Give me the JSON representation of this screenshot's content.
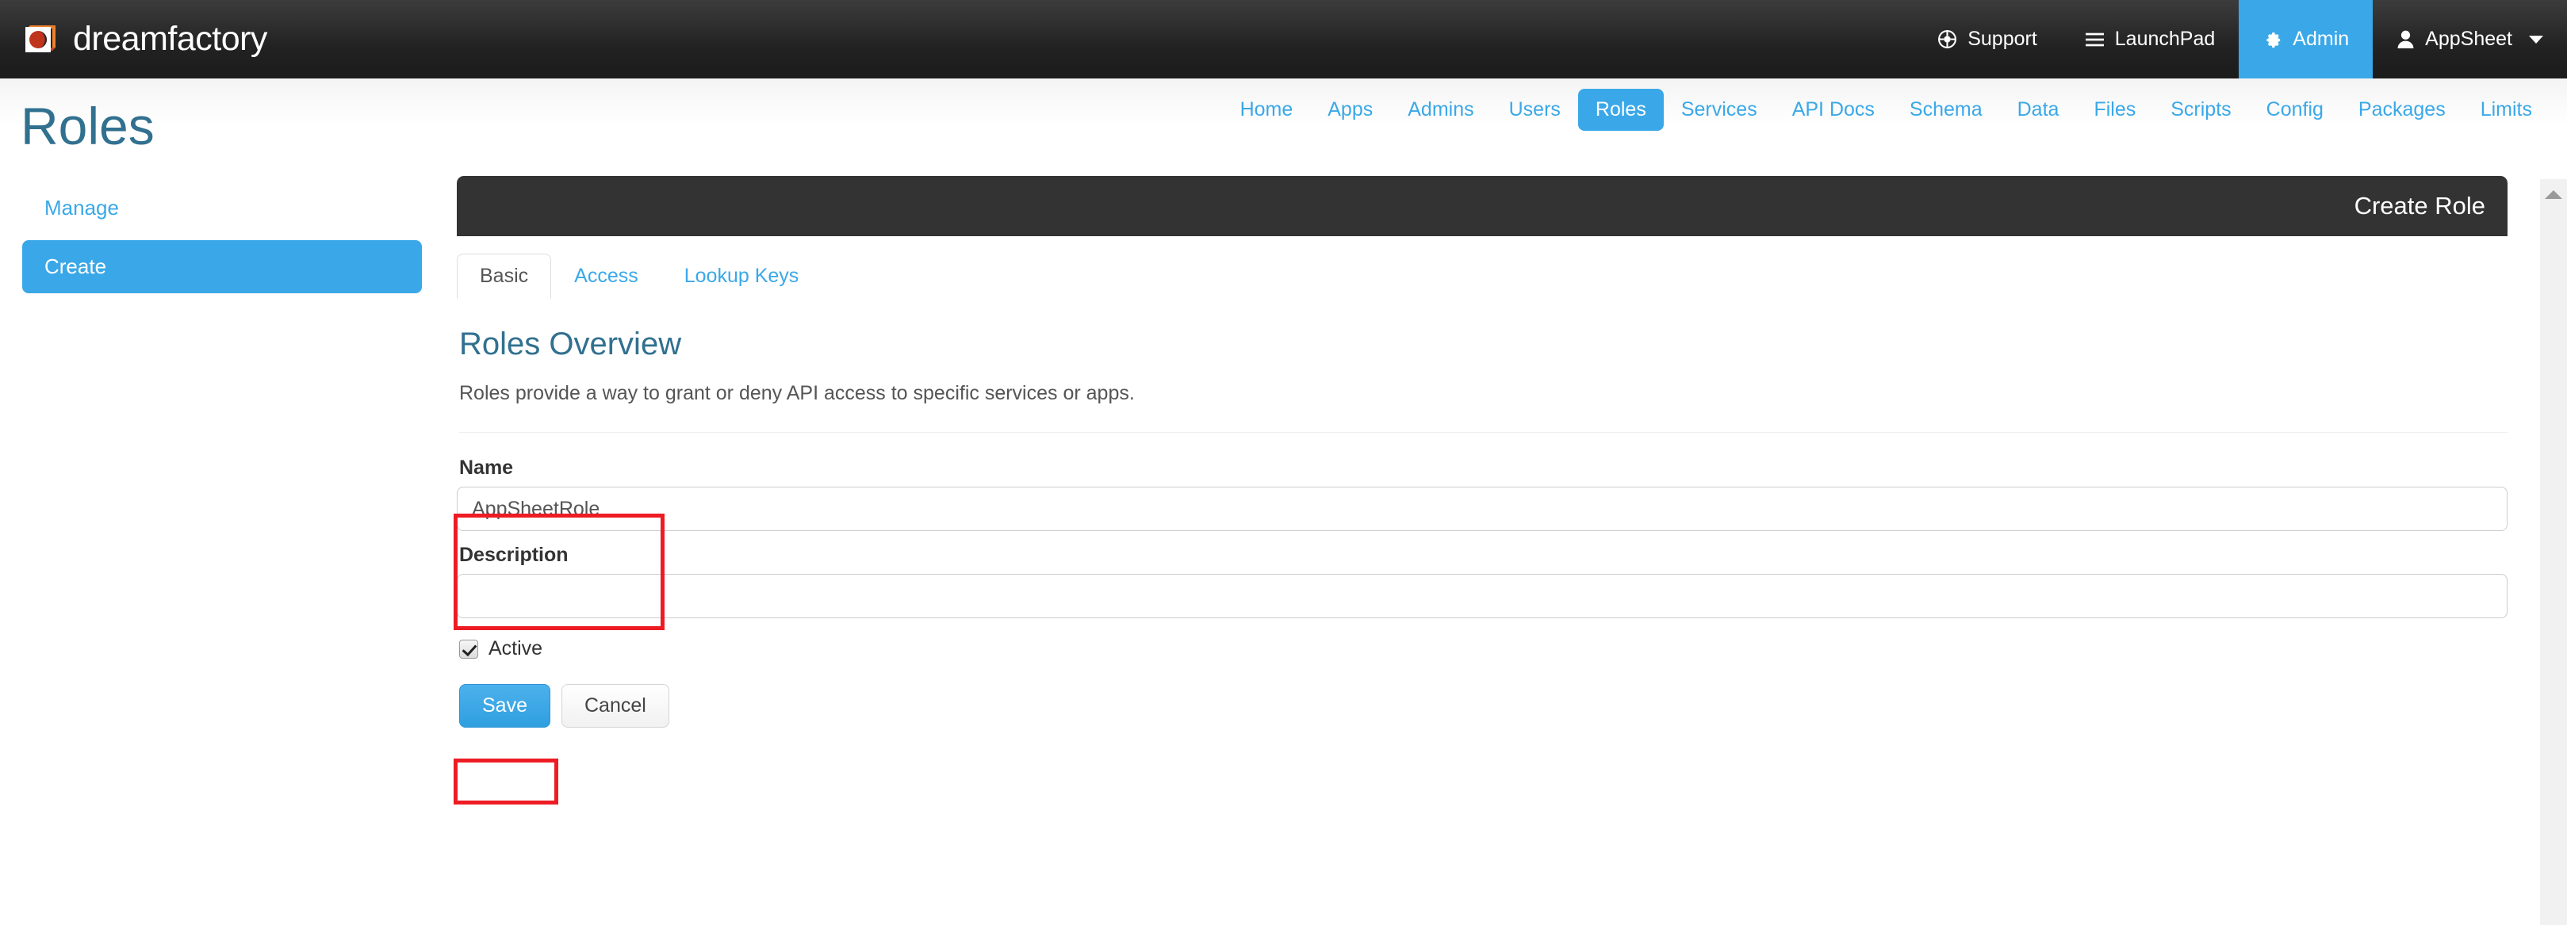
{
  "brand": {
    "name": "dreamfactory",
    "logo_icon": "dreamfactory-logo-icon"
  },
  "topnav": {
    "items": [
      {
        "label": "Support",
        "icon": "lifebuoy-icon",
        "active": false
      },
      {
        "label": "LaunchPad",
        "icon": "hamburger-icon",
        "active": false
      },
      {
        "label": "Admin",
        "icon": "gear-icon",
        "active": true
      },
      {
        "label": "AppSheet",
        "icon": "user-icon",
        "active": false,
        "caret": true
      }
    ]
  },
  "subnav": {
    "items": [
      {
        "label": "Home",
        "active": false
      },
      {
        "label": "Apps",
        "active": false
      },
      {
        "label": "Admins",
        "active": false
      },
      {
        "label": "Users",
        "active": false
      },
      {
        "label": "Roles",
        "active": true
      },
      {
        "label": "Services",
        "active": false
      },
      {
        "label": "API Docs",
        "active": false
      },
      {
        "label": "Schema",
        "active": false
      },
      {
        "label": "Data",
        "active": false
      },
      {
        "label": "Files",
        "active": false
      },
      {
        "label": "Scripts",
        "active": false
      },
      {
        "label": "Config",
        "active": false
      },
      {
        "label": "Packages",
        "active": false
      },
      {
        "label": "Limits",
        "active": false
      }
    ]
  },
  "sidebar": {
    "title": "Roles",
    "items": [
      {
        "label": "Manage",
        "active": false
      },
      {
        "label": "Create",
        "active": true
      }
    ]
  },
  "panel": {
    "header_title": "Create Role",
    "tabs": [
      {
        "label": "Basic",
        "active": true
      },
      {
        "label": "Access",
        "active": false
      },
      {
        "label": "Lookup Keys",
        "active": false
      }
    ],
    "section_title": "Roles Overview",
    "section_desc": "Roles provide a way to grant or deny API access to specific services or apps.",
    "fields": {
      "name": {
        "label": "Name",
        "value": "AppSheetRole",
        "placeholder": ""
      },
      "description": {
        "label": "Description",
        "value": "",
        "placeholder": ""
      },
      "active": {
        "label": "Active",
        "checked": true
      }
    },
    "buttons": {
      "save": "Save",
      "cancel": "Cancel"
    }
  },
  "annotations": {
    "highlight_color": "#ed1c24",
    "boxes": [
      {
        "name": "name-field-highlight"
      },
      {
        "name": "active-checkbox-highlight"
      }
    ]
  },
  "colors": {
    "brand_accent": "#3aa8e8",
    "navbar_bg": "#222222",
    "panel_header_bg": "#333333",
    "heading_blue": "#31708f"
  },
  "scrollbar": {
    "up_arrow_icon": "triangle-up-icon"
  }
}
